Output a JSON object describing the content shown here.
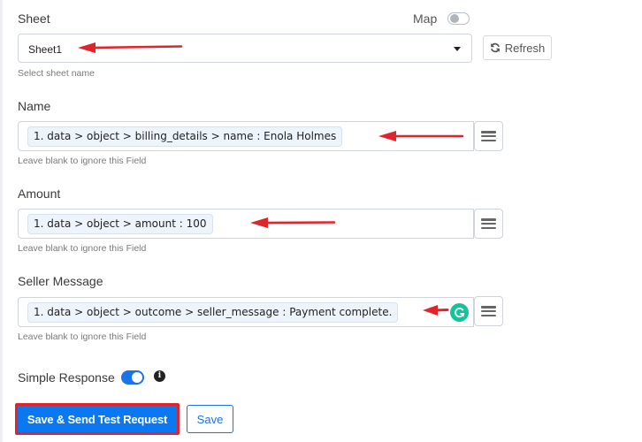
{
  "sheet": {
    "label": "Sheet",
    "selected": "Sheet1",
    "help": "Select sheet name",
    "map_label": "Map",
    "map_enabled": false,
    "refresh_label": "Refresh"
  },
  "fields": [
    {
      "label": "Name",
      "value": "1. data > object > billing_details > name : Enola Holmes",
      "help": "Leave blank to ignore this Field"
    },
    {
      "label": "Amount",
      "value": "1. data > object > amount : 100",
      "help": "Leave blank to ignore this Field"
    },
    {
      "label": "Seller Message",
      "value": "1. data > object > outcome > seller_message : Payment complete.",
      "help": "Leave blank to ignore this Field"
    }
  ],
  "simple_response": {
    "label": "Simple Response",
    "enabled": true
  },
  "actions": {
    "primary_label": "Save & Send Test Request",
    "save_label": "Save"
  },
  "colors": {
    "accent": "#1a73e8",
    "primary_button": "#0b77f0",
    "annotation_red": "#e0242b",
    "grammarly": "#15c39a"
  }
}
